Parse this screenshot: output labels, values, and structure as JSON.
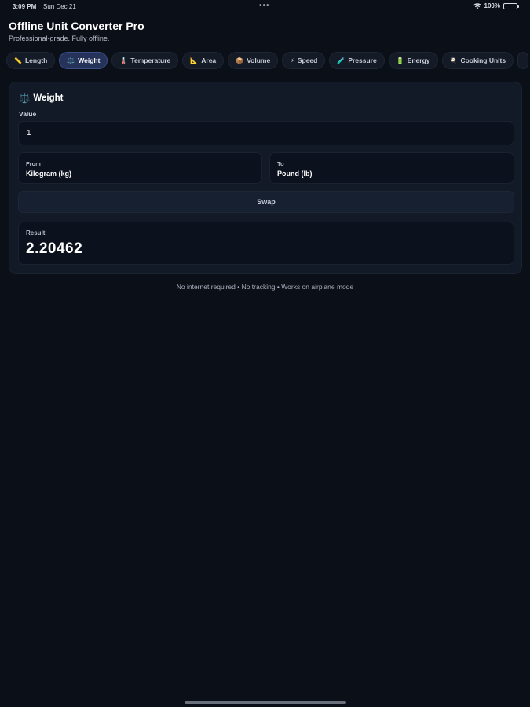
{
  "status_bar": {
    "time": "3:09 PM",
    "date": "Sun Dec 21",
    "battery": "100%"
  },
  "app": {
    "title": "Offline Unit Converter Pro",
    "subtitle": "Professional-grade. Fully offline."
  },
  "tabs": [
    {
      "label": "Length",
      "icon": "📏",
      "active": false
    },
    {
      "label": "Weight",
      "icon": "⚖️",
      "active": true
    },
    {
      "label": "Temperature",
      "icon": "🌡️",
      "active": false
    },
    {
      "label": "Area",
      "icon": "📐",
      "active": false
    },
    {
      "label": "Volume",
      "icon": "📦",
      "active": false
    },
    {
      "label": "Speed",
      "icon": "⚡",
      "active": false
    },
    {
      "label": "Pressure",
      "icon": "🧪",
      "active": false
    },
    {
      "label": "Energy",
      "icon": "🔋",
      "active": false
    },
    {
      "label": "Cooking Units",
      "icon": "🍳",
      "active": false
    }
  ],
  "converter": {
    "title": "Weight",
    "icon": "⚖️",
    "value_label": "Value",
    "value": "1",
    "from_label": "From",
    "from_value": "Kilogram (kg)",
    "to_label": "To",
    "to_value": "Pound (lb)",
    "swap_label": "Swap",
    "result_label": "Result",
    "result_value": "2.20462"
  },
  "footer": "No internet required • No tracking • Works on airplane mode"
}
